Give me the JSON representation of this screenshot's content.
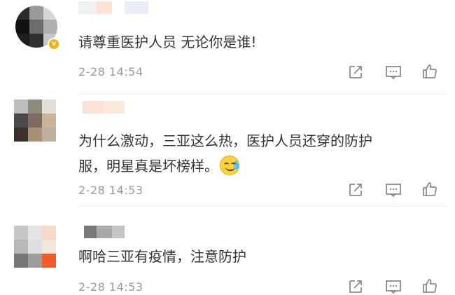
{
  "comments": [
    {
      "text": "请尊重医护人员 无论你是谁!",
      "time": "2-28 14:54",
      "verified": true
    },
    {
      "text_line1": "为什么激动，三亚这么热，医护人员还穿的防护",
      "text_line2": "服，明星真是坏榜样。",
      "emoji": "sweat-smile-emoji",
      "time": "2-28 14:53"
    },
    {
      "text": "啊哈三亚有疫情，注意防护",
      "time": "2-28 14:53"
    }
  ],
  "actions": [
    "share-icon",
    "comment-icon",
    "like-icon"
  ],
  "colors": {
    "text": "#333333",
    "time": "#9a9a9a",
    "icon": "#8a8a8a",
    "verified": "#f5b10a",
    "divider": "#ececec"
  }
}
